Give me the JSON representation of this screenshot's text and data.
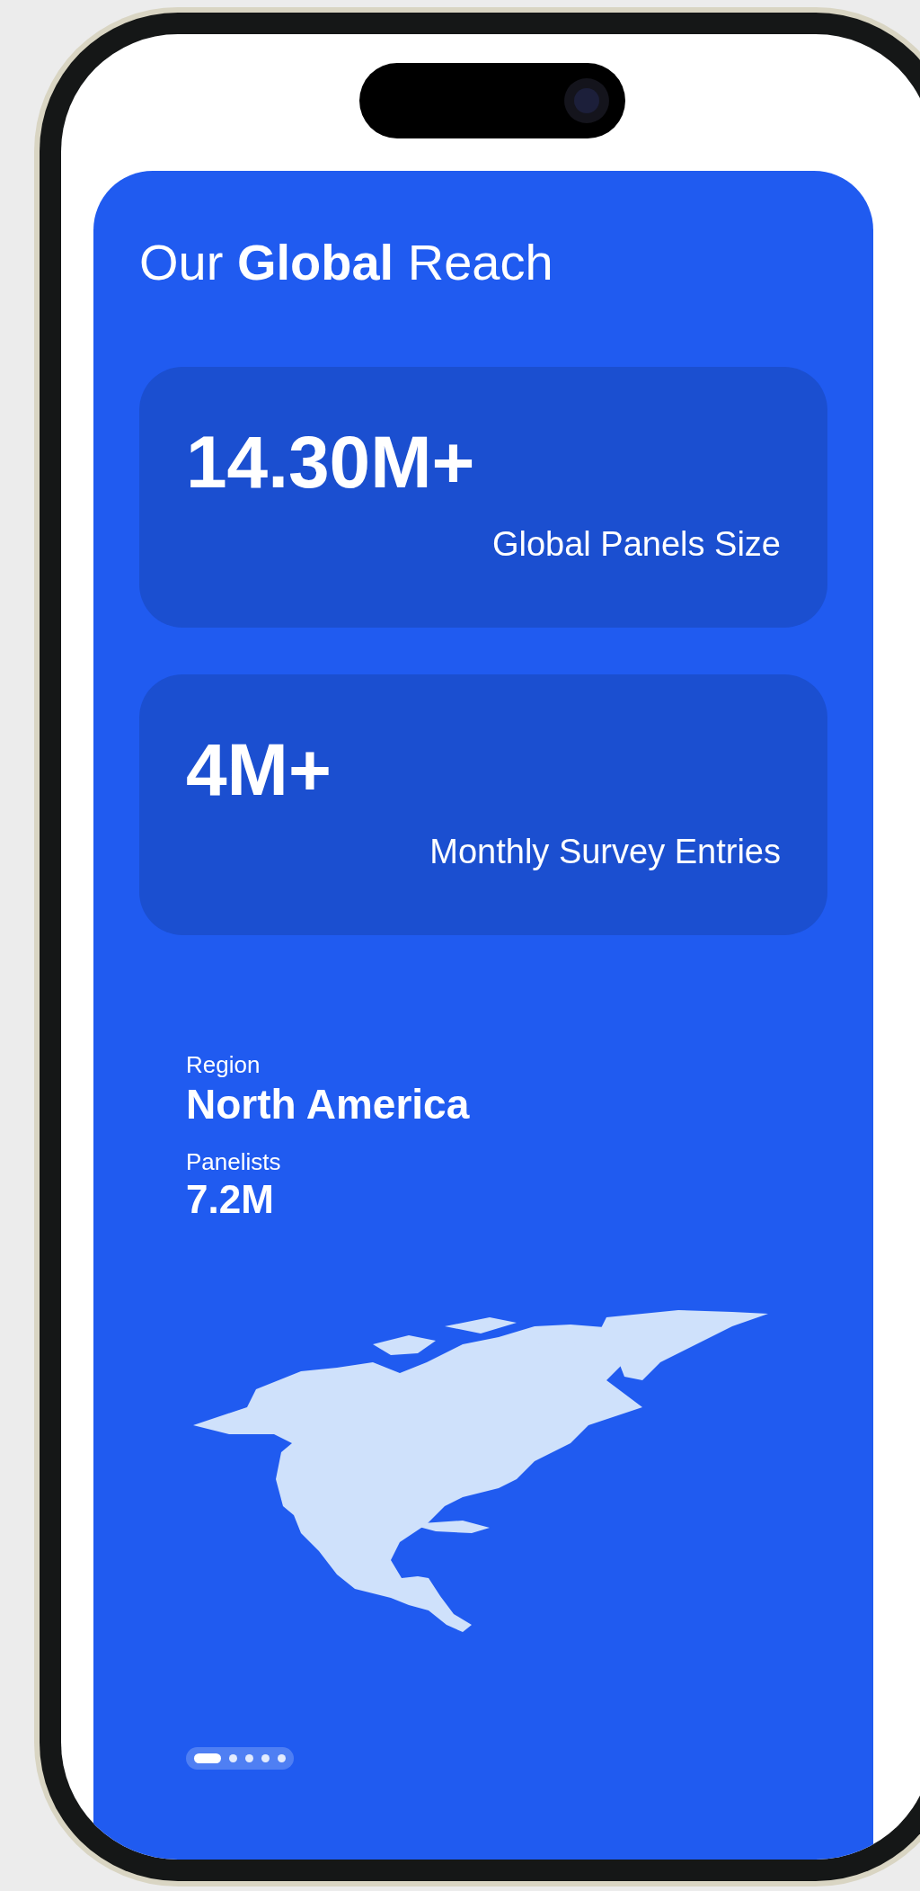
{
  "heading": "Our **Global** Reach",
  "stats": [
    {
      "value": "14.30M+",
      "label": "Global Panels Size"
    },
    {
      "value": "4M+",
      "label": "Monthly Survey Entries"
    }
  ],
  "region": {
    "label": "Region",
    "name": "North America",
    "panelists_label": "Panelists",
    "panelists_value": "7.2M"
  },
  "pagination": [
    {
      "selected": true
    },
    {
      "selected": false
    },
    {
      "selected": false
    },
    {
      "selected": false
    },
    {
      "selected": false
    }
  ]
}
